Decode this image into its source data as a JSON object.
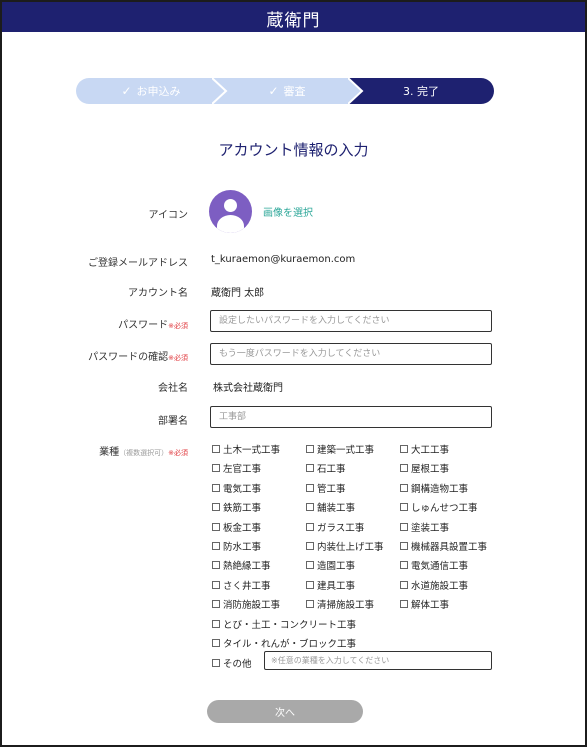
{
  "header": {
    "logo": "蔵衛門"
  },
  "steps": [
    {
      "label": "お申込み",
      "status": "done"
    },
    {
      "label": "審査",
      "status": "done"
    },
    {
      "label": "3. 完了",
      "status": "current"
    }
  ],
  "colors": {
    "navy": "#1e2170",
    "step_done": "#c8d8f3",
    "accent_green": "#2fa89a",
    "required_red": "#e0393e",
    "avatar_purple": "#7d5ec2",
    "button_gray": "#a9a9a9"
  },
  "page_title": "アカウント情報の入力",
  "form": {
    "icon_label": "アイコン",
    "select_image": "画像を選択",
    "email_label": "ご登録メールアドレス",
    "email_value": "t_kuraemon@kuraemon.com",
    "account_label": "アカウント名",
    "account_value": "蔵衛門 太郎",
    "password_label": "パスワード",
    "required_mark": "※必須",
    "password_placeholder": "設定したいパスワードを入力してください",
    "password_confirm_label": "パスワードの確認",
    "password_confirm_placeholder": "もう一度パスワードを入力してください",
    "company_label": "会社名",
    "company_value": "株式会社蔵衛門",
    "department_label": "部署名",
    "department_placeholder": "工事部",
    "industry_label": "業種",
    "industry_note": "（複数選択可）",
    "industries": [
      "土木一式工事",
      "建築一式工事",
      "大工工事",
      "左官工事",
      "石工事",
      "屋根工事",
      "電気工事",
      "管工事",
      "鋼構造物工事",
      "鉄筋工事",
      "舗装工事",
      "しゅんせつ工事",
      "板金工事",
      "ガラス工事",
      "塗装工事",
      "防水工事",
      "内装仕上げ工事",
      "機械器具設置工事",
      "熱絶縁工事",
      "造園工事",
      "電気通信工事",
      "さく井工事",
      "建具工事",
      "水道施設工事",
      "消防施設工事",
      "清掃施設工事",
      "解体工事",
      "とび・土工・コンクリート工事",
      "タイル・れんが・ブロック工事"
    ],
    "other_label": "その他",
    "other_placeholder": "※任意の業種を入力してください"
  },
  "next_button": "次へ"
}
